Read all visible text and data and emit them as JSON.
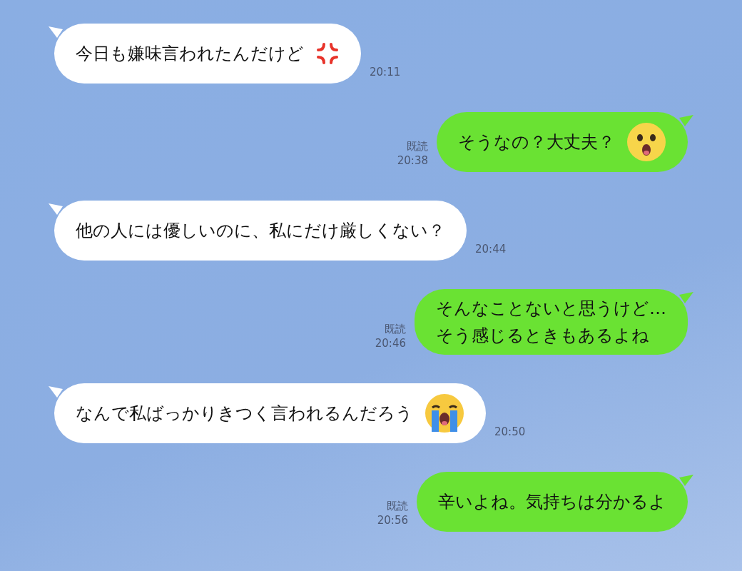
{
  "messages": [
    {
      "kind": "incoming",
      "text": "今日も嫌味言われたんだけど",
      "emoji": {
        "kind": "anger"
      },
      "time": "20:11"
    },
    {
      "kind": "outgoing",
      "text": "そうなの？大丈夫？",
      "emoji": {
        "kind": "surprised"
      },
      "read": "既読",
      "time": "20:38"
    },
    {
      "kind": "incoming",
      "text": "他の人には優しいのに、私にだけ厳しくない？",
      "time": "20:44"
    },
    {
      "kind": "outgoing",
      "text": "そんなことないと思うけど…\nそう感じるときもあるよね",
      "read": "既読",
      "time": "20:46"
    },
    {
      "kind": "incoming",
      "text": "なんで私ばっかりきつく言われるんだろう",
      "emoji": {
        "kind": "crying"
      },
      "time": "20:50"
    },
    {
      "kind": "outgoing",
      "text": "辛いよね。気持ちは分かるよ",
      "read": "既読",
      "time": "20:56"
    }
  ]
}
